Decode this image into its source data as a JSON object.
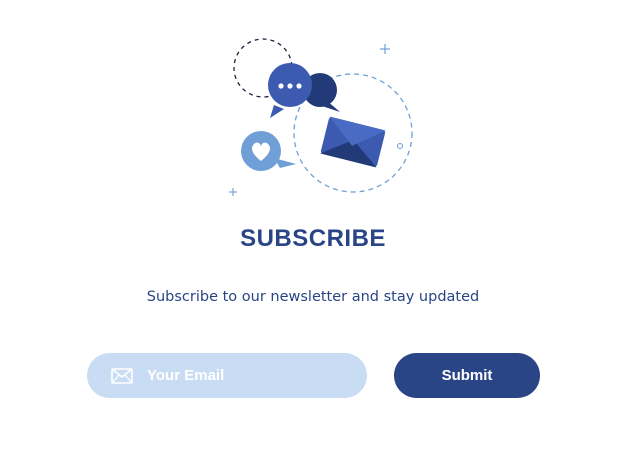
{
  "colors": {
    "accent": "#2a4585",
    "field_background": "#c8dcf4",
    "bubble_blue": "#3c5bb0",
    "bubble_dark": "#233a78",
    "heart_bubble": "#6f9fd6"
  },
  "illustration": {
    "icons": [
      "chat-bubble-icon",
      "envelope-icon",
      "heart-bubble-icon"
    ]
  },
  "heading": {
    "title": "SUBSCRIBE",
    "subtitle": "Subscribe to our newsletter and stay updated"
  },
  "form": {
    "email_icon": "envelope-icon",
    "email_placeholder": "Your Email",
    "email_value": "",
    "submit_label": "Submit"
  }
}
